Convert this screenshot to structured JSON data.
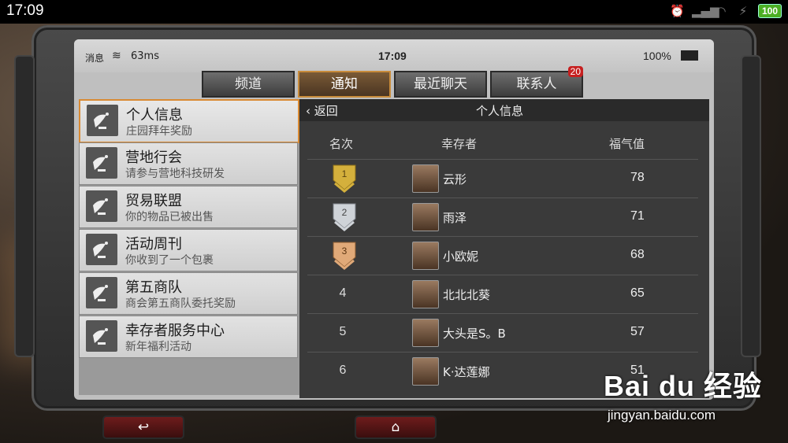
{
  "os_status": {
    "time": "17:09",
    "battery": "100"
  },
  "game_status": {
    "message": "消息",
    "ping": "63ms",
    "time": "17:09",
    "battery": "100%"
  },
  "tabs": [
    {
      "label": "频道",
      "active": false
    },
    {
      "label": "通知",
      "active": true
    },
    {
      "label": "最近聊天",
      "active": false
    },
    {
      "label": "联系人",
      "active": false,
      "badge": "20"
    }
  ],
  "list": [
    {
      "title": "个人信息",
      "subtitle": "庄园拜年奖励",
      "active": true
    },
    {
      "title": "营地行会",
      "subtitle": "请参与营地科技研发"
    },
    {
      "title": "贸易联盟",
      "subtitle": "你的物品已被出售"
    },
    {
      "title": "活动周刊",
      "subtitle": "你收到了一个包裹"
    },
    {
      "title": "第五商队",
      "subtitle": "商会第五商队委托奖励"
    },
    {
      "title": "幸存者服务中心",
      "subtitle": "新年福利活动"
    }
  ],
  "panel": {
    "back": "返回",
    "title": "个人信息",
    "headers": {
      "rank": "名次",
      "survivor": "幸存者",
      "luck": "福气值"
    },
    "rows": [
      {
        "rank": "1",
        "name": "云形",
        "score": "78",
        "medal": "gold"
      },
      {
        "rank": "2",
        "name": "雨泽",
        "score": "71",
        "medal": "silver"
      },
      {
        "rank": "3",
        "name": "小欧妮",
        "score": "68",
        "medal": "bronze"
      },
      {
        "rank": "4",
        "name": "北北北葵",
        "score": "65"
      },
      {
        "rank": "5",
        "name": "大头是S。B",
        "score": "57"
      },
      {
        "rank": "6",
        "name": "K·达莲娜",
        "score": "51"
      }
    ]
  },
  "watermark": {
    "brand": "Bai du 经验",
    "url": "jingyan.baidu.com"
  },
  "colors": {
    "accent": "#d98a33",
    "tab_active": "#c88b3a",
    "badge": "#c62020"
  }
}
